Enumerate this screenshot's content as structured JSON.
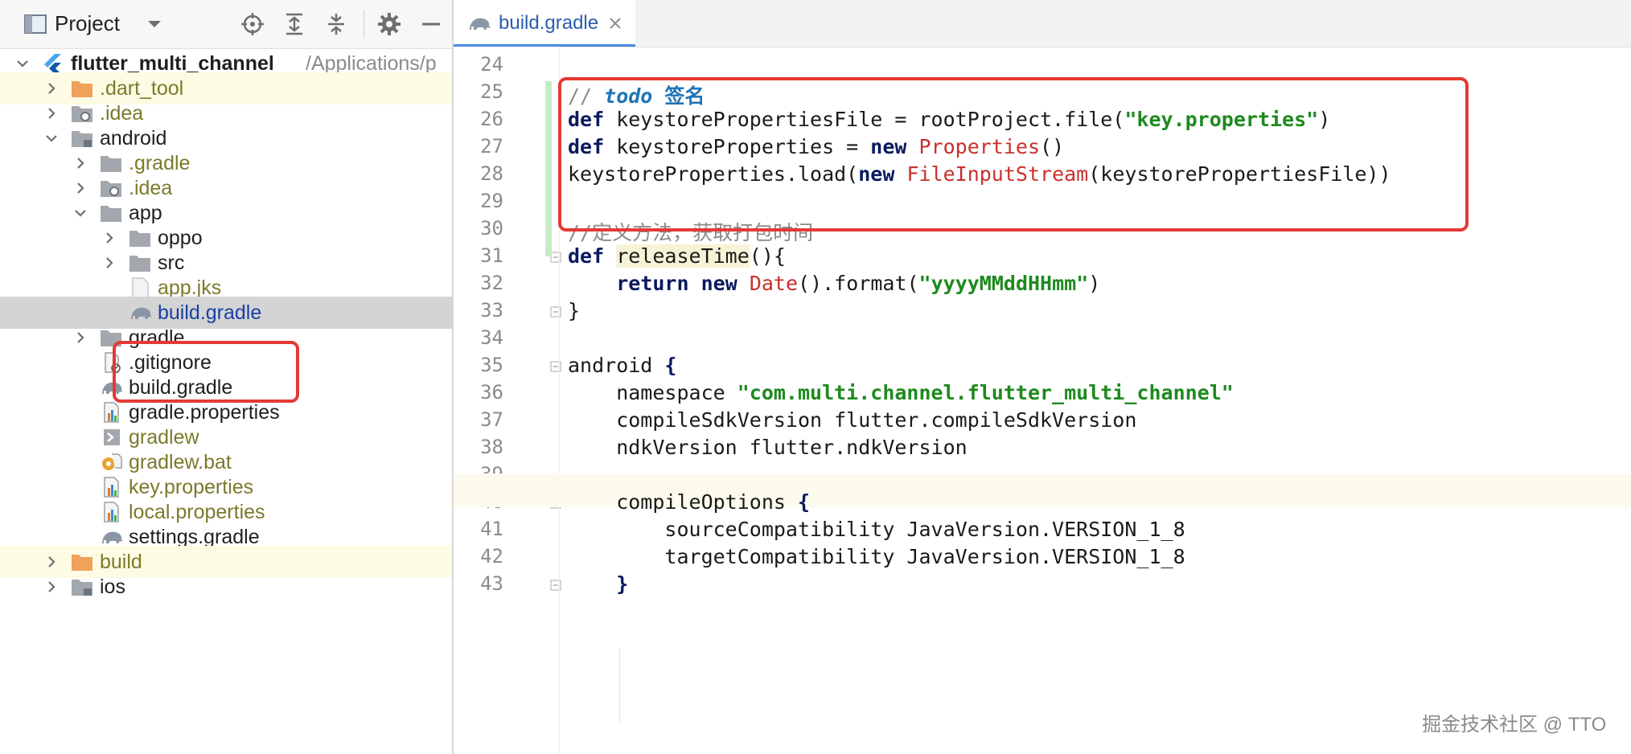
{
  "project_panel": {
    "title": "Project",
    "tree": [
      {
        "label": "flutter_multi_channel",
        "path": "/Applications/p",
        "depth": 0,
        "chevron": "down",
        "icon": "flutter-icon",
        "bold": true
      },
      {
        "label": ".dart_tool",
        "depth": 1,
        "chevron": "right",
        "icon": "orange-folder-icon",
        "color": "olive",
        "hl": "yellow"
      },
      {
        "label": ".idea",
        "depth": 1,
        "chevron": "right",
        "icon": "config-folder-icon",
        "color": "olive"
      },
      {
        "label": "android",
        "depth": 1,
        "chevron": "down",
        "icon": "module-folder-icon"
      },
      {
        "label": ".gradle",
        "depth": 2,
        "chevron": "right",
        "icon": "folder-icon",
        "color": "olive"
      },
      {
        "label": ".idea",
        "depth": 2,
        "chevron": "right",
        "icon": "config-folder-icon",
        "color": "olive"
      },
      {
        "label": "app",
        "depth": 2,
        "chevron": "down",
        "icon": "folder-icon"
      },
      {
        "label": "oppo",
        "depth": 3,
        "chevron": "right",
        "icon": "folder-icon"
      },
      {
        "label": "src",
        "depth": 3,
        "chevron": "right",
        "icon": "folder-icon"
      },
      {
        "label": "app.jks",
        "depth": 3,
        "chevron": "",
        "icon": "file-icon",
        "color": "olive"
      },
      {
        "label": "build.gradle",
        "depth": 3,
        "chevron": "",
        "icon": "gradle-elephant-icon",
        "color": "blue",
        "hl": "grey"
      },
      {
        "label": "gradle",
        "depth": 2,
        "chevron": "right",
        "icon": "folder-icon"
      },
      {
        "label": ".gitignore",
        "depth": 2,
        "chevron": "",
        "icon": "gitignore-file-icon"
      },
      {
        "label": "build.gradle",
        "depth": 2,
        "chevron": "",
        "icon": "gradle-elephant-icon"
      },
      {
        "label": "gradle.properties",
        "depth": 2,
        "chevron": "",
        "icon": "properties-file-icon"
      },
      {
        "label": "gradlew",
        "depth": 2,
        "chevron": "",
        "icon": "script-file-icon",
        "color": "olive"
      },
      {
        "label": "gradlew.bat",
        "depth": 2,
        "chevron": "",
        "icon": "bat-gear-file-icon",
        "color": "olive"
      },
      {
        "label": "key.properties",
        "depth": 2,
        "chevron": "",
        "icon": "properties-file-icon",
        "color": "olive"
      },
      {
        "label": "local.properties",
        "depth": 2,
        "chevron": "",
        "icon": "properties-file-icon",
        "color": "olive"
      },
      {
        "label": "settings.gradle",
        "depth": 2,
        "chevron": "",
        "icon": "gradle-elephant-icon"
      },
      {
        "label": "build",
        "depth": 1,
        "chevron": "right",
        "icon": "orange-folder-icon",
        "color": "olive",
        "hl": "yellow"
      },
      {
        "label": "ios",
        "depth": 1,
        "chevron": "right",
        "icon": "module-folder-icon"
      }
    ]
  },
  "editor": {
    "tab_label": "build.gradle",
    "lines": [
      {
        "n": "24",
        "segs": []
      },
      {
        "n": "25",
        "segs": [
          {
            "t": "// ",
            "c": "cmt"
          },
          {
            "t": "todo ",
            "c": "todo"
          },
          {
            "t": "签名",
            "c": "todo-cn"
          }
        ]
      },
      {
        "n": "26",
        "segs": [
          {
            "t": "def",
            "c": "kw"
          },
          {
            "t": " keystorePropertiesFile = rootProject.file("
          },
          {
            "t": "\"key.properties\"",
            "c": "str"
          },
          {
            "t": ")"
          }
        ]
      },
      {
        "n": "27",
        "segs": [
          {
            "t": "def",
            "c": "kw"
          },
          {
            "t": " keystoreProperties = "
          },
          {
            "t": "new",
            "c": "kw"
          },
          {
            "t": " "
          },
          {
            "t": "Properties",
            "c": "cls"
          },
          {
            "t": "()"
          }
        ]
      },
      {
        "n": "28",
        "segs": [
          {
            "t": "keystoreProperties.load("
          },
          {
            "t": "new",
            "c": "kw"
          },
          {
            "t": " "
          },
          {
            "t": "FileInputStream",
            "c": "cls"
          },
          {
            "t": "(keystorePropertiesFile))"
          }
        ]
      },
      {
        "n": "29",
        "segs": []
      },
      {
        "n": "30",
        "segs": [
          {
            "t": "//定义方法，获取打包时间",
            "c": "cmt"
          }
        ]
      },
      {
        "n": "31",
        "segs": [
          {
            "t": "def",
            "c": "kw"
          },
          {
            "t": " "
          },
          {
            "t": "releaseTime",
            "c": "fnhl"
          },
          {
            "t": "(){"
          }
        ]
      },
      {
        "n": "32",
        "segs": [
          {
            "t": "    "
          },
          {
            "t": "return",
            "c": "kw"
          },
          {
            "t": " "
          },
          {
            "t": "new",
            "c": "kw"
          },
          {
            "t": " "
          },
          {
            "t": "Date",
            "c": "cls"
          },
          {
            "t": "().format("
          },
          {
            "t": "\"yyyyMMddHHmm\"",
            "c": "str"
          },
          {
            "t": ")"
          }
        ]
      },
      {
        "n": "33",
        "segs": [
          {
            "t": "}"
          }
        ]
      },
      {
        "n": "34",
        "segs": []
      },
      {
        "n": "35",
        "segs": [
          {
            "t": "android "
          },
          {
            "t": "{",
            "c": "kw"
          }
        ]
      },
      {
        "n": "36",
        "segs": [
          {
            "t": "    namespace "
          },
          {
            "t": "\"com.multi.channel.flutter_multi_channel\"",
            "c": "str"
          }
        ]
      },
      {
        "n": "37",
        "segs": [
          {
            "t": "    compileSdkVersion flutter.compileSdkVersion"
          }
        ]
      },
      {
        "n": "38",
        "segs": [
          {
            "t": "    ndkVersion flutter.ndkVersion"
          }
        ]
      },
      {
        "n": "39",
        "segs": []
      },
      {
        "n": "40",
        "segs": [
          {
            "t": "    compileOptions "
          },
          {
            "t": "{",
            "c": "kw"
          }
        ]
      },
      {
        "n": "41",
        "segs": [
          {
            "t": "        sourceCompatibility JavaVersion.VERSION_1_8"
          }
        ]
      },
      {
        "n": "42",
        "segs": [
          {
            "t": "        targetCompatibility JavaVersion.VERSION_1_8"
          }
        ]
      },
      {
        "n": "43",
        "segs": [
          {
            "t": "    "
          },
          {
            "t": "}",
            "c": "kw"
          }
        ]
      }
    ]
  },
  "watermark": "掘金技术社区 @ TTO",
  "colors": {
    "highlight_box": "#e53935",
    "accent": "#4a8be0",
    "change_marker": "#c6ecc6"
  }
}
